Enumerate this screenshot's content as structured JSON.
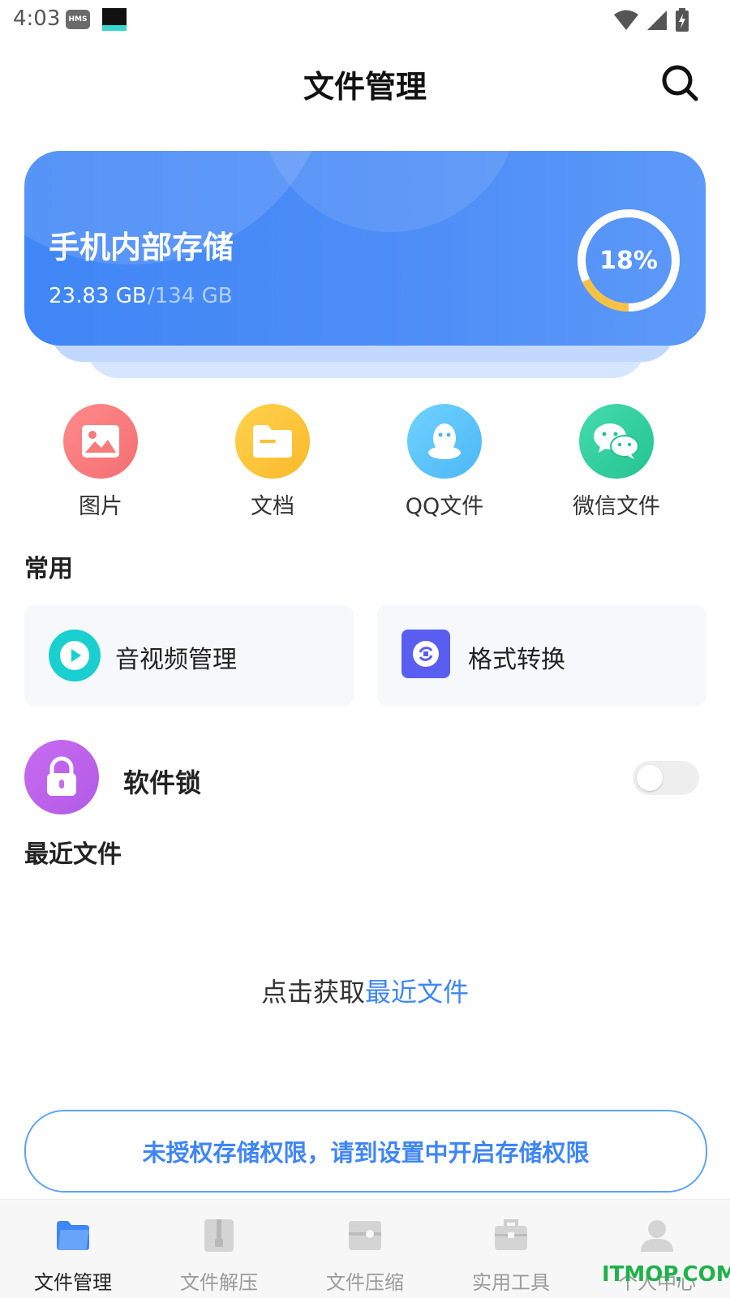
{
  "status_bar": {
    "time": "4:03",
    "hms_badge": "HMS",
    "icons": [
      "wifi-icon",
      "signal-icon",
      "battery-charging-icon"
    ]
  },
  "header": {
    "title": "文件管理",
    "search_icon": "search-icon"
  },
  "storage": {
    "title": "手机内部存储",
    "used": "23.83 GB",
    "total": "/134 GB",
    "percent_label": "18%",
    "percent_value": 18,
    "ring_track_color": "#ffffff",
    "ring_fill_color": "#f7c244"
  },
  "categories": [
    {
      "label": "图片",
      "icon": "image-icon",
      "color": "#f77b7b"
    },
    {
      "label": "文档",
      "icon": "folder-icon",
      "color": "#f9c03a"
    },
    {
      "label": "QQ文件",
      "icon": "qq-icon",
      "color": "#5cc6f7"
    },
    {
      "label": "微信文件",
      "icon": "wechat-icon",
      "color": "#34d0a0"
    }
  ],
  "common": {
    "title": "常用",
    "items": [
      {
        "label": "音视频管理",
        "icon": "play-icon"
      },
      {
        "label": "格式转换",
        "icon": "convert-icon"
      }
    ]
  },
  "software_lock": {
    "label": "软件锁",
    "icon": "lock-icon",
    "enabled": false
  },
  "recent": {
    "title": "最近文件",
    "hint_prefix": "点击获取",
    "hint_link": "最近文件"
  },
  "permission_banner": {
    "text": "未授权存储权限，请到设置中开启存储权限"
  },
  "bottom_nav": {
    "items": [
      {
        "label": "文件管理",
        "icon": "folder-tab-icon",
        "active": true
      },
      {
        "label": "文件解压",
        "icon": "zip-icon",
        "active": false
      },
      {
        "label": "文件压缩",
        "icon": "compress-icon",
        "active": false
      },
      {
        "label": "实用工具",
        "icon": "toolbox-icon",
        "active": false
      },
      {
        "label": "个人中心",
        "icon": "user-icon",
        "active": false
      }
    ]
  },
  "watermark": "ITMOP.COM",
  "colors": {
    "accent": "#3f86f6",
    "text_primary": "#222222",
    "text_muted": "#9b9b9b"
  }
}
